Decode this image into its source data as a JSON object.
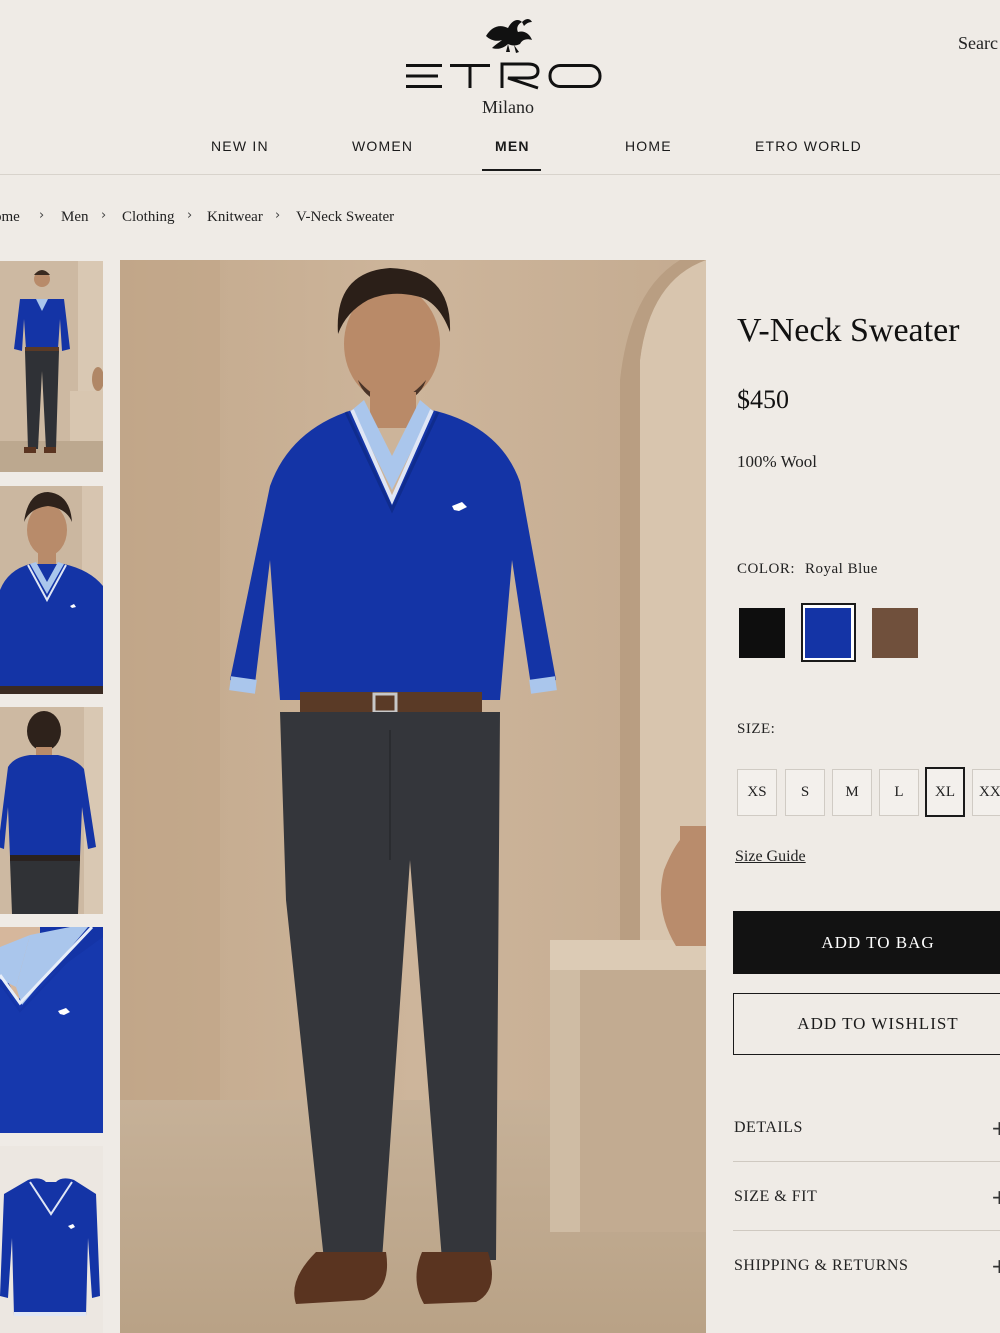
{
  "header": {
    "brand": "ETRO",
    "brand_sub": "Milano",
    "search_label": "Searc"
  },
  "nav": {
    "items": [
      {
        "label": "NEW IN"
      },
      {
        "label": "WOMEN"
      },
      {
        "label": "MEN",
        "active": true
      },
      {
        "label": "HOME"
      },
      {
        "label": "ETRO WORLD"
      }
    ]
  },
  "breadcrumb": {
    "items": [
      "ome",
      "Men",
      "Clothing",
      "Knitwear",
      "V-Neck Sweater"
    ],
    "separator": "›"
  },
  "gallery": {
    "thumbnails": [
      {
        "icon": "full-body-photo"
      },
      {
        "icon": "upper-body-photo"
      },
      {
        "icon": "back-view-photo"
      },
      {
        "icon": "collar-detail-photo"
      },
      {
        "icon": "flat-lay-photo"
      }
    ],
    "main_icon": "model-full-length-photo"
  },
  "product": {
    "title": "V-Neck Sweater",
    "price": "$450",
    "material": "100% Wool",
    "color_label": "COLOR:",
    "color_value": "Royal Blue",
    "swatches": [
      {
        "name": "Black",
        "hex": "#0e0e0e"
      },
      {
        "name": "Royal Blue",
        "hex": "#1434a6",
        "selected": true
      },
      {
        "name": "Brown",
        "hex": "#70503c"
      }
    ],
    "size_label": "SIZE:",
    "sizes": [
      {
        "label": "XS"
      },
      {
        "label": "S"
      },
      {
        "label": "M"
      },
      {
        "label": "L"
      },
      {
        "label": "XL",
        "selected": true
      },
      {
        "label": "XXL"
      }
    ],
    "size_guide_label": "Size Guide",
    "add_to_bag_label": "ADD TO BAG",
    "add_to_wishlist_label": "ADD TO WISHLIST",
    "accordions": [
      {
        "label": "DETAILS",
        "toggle": "+"
      },
      {
        "label": "SIZE & FIT",
        "toggle": "+"
      },
      {
        "label": "SHIPPING & RETURNS",
        "toggle": "+"
      }
    ]
  },
  "colors": {
    "background": "#efebe6",
    "accent": "#121212",
    "sweater": "#1434a6"
  }
}
